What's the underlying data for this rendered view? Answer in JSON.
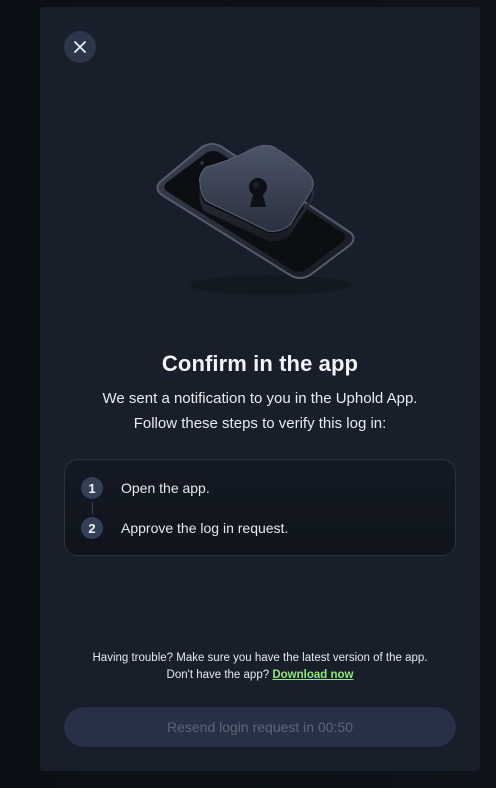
{
  "modal": {
    "title": "Confirm in the app",
    "subtitle_line1": "We sent a notification to you in the Uphold App.",
    "subtitle_line2": "Follow these steps to verify this log in:",
    "steps": [
      {
        "number": "1",
        "label": "Open the app."
      },
      {
        "number": "2",
        "label": "Approve the log in request."
      }
    ],
    "help_line1": "Having trouble? Make sure you have the latest version of the app.",
    "help_line2_prefix": "Don't have the app?",
    "download_link": "Download now",
    "resend_button": "Resend login request in 00:50",
    "resend_disabled": true
  },
  "icons": {
    "close": "close-icon",
    "illustration": "phone-shield-lock-illustration"
  },
  "colors": {
    "modal_bg": "#181e2a",
    "page_bg": "#0c1118",
    "link": "#8fe87a",
    "button_bg": "#273044",
    "button_text": "#5b6678"
  }
}
